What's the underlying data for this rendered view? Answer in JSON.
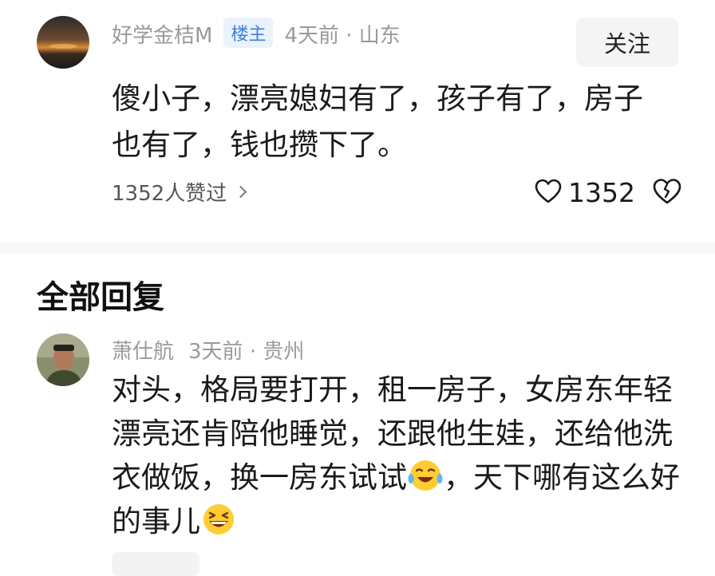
{
  "post": {
    "author": "好学金桔M",
    "badge": "楼主",
    "meta": "4天前 · 山东",
    "follow_label": "关注",
    "text": "傻小子，漂亮媳妇有了，孩子有了，房子也有了，钱也攒下了。",
    "likes_summary": "1352人赞过",
    "like_count": "1352",
    "icons": [
      "like-heart-icon",
      "dislike-broken-heart-icon",
      "chevron-right-icon"
    ]
  },
  "section": {
    "title": "全部回复"
  },
  "reply": {
    "author": "萧仕航",
    "meta": "3天前 · 贵州",
    "text_part1": "对头，格局要打开，租一房子，女房东年轻漂亮还肯陪他睡觉，还跟他生娃，还给他洗衣做饭，换一房东试试",
    "text_part2": "，天下哪有这么好的事儿",
    "emojis": [
      "laughing-crying-emoji",
      "grinning-squint-emoji"
    ]
  },
  "colors": {
    "meta": "#9a9a9a",
    "badge_text": "#3f7fd8",
    "badge_bg": "#eaf2fd",
    "body_text": "#1a1a1a"
  }
}
